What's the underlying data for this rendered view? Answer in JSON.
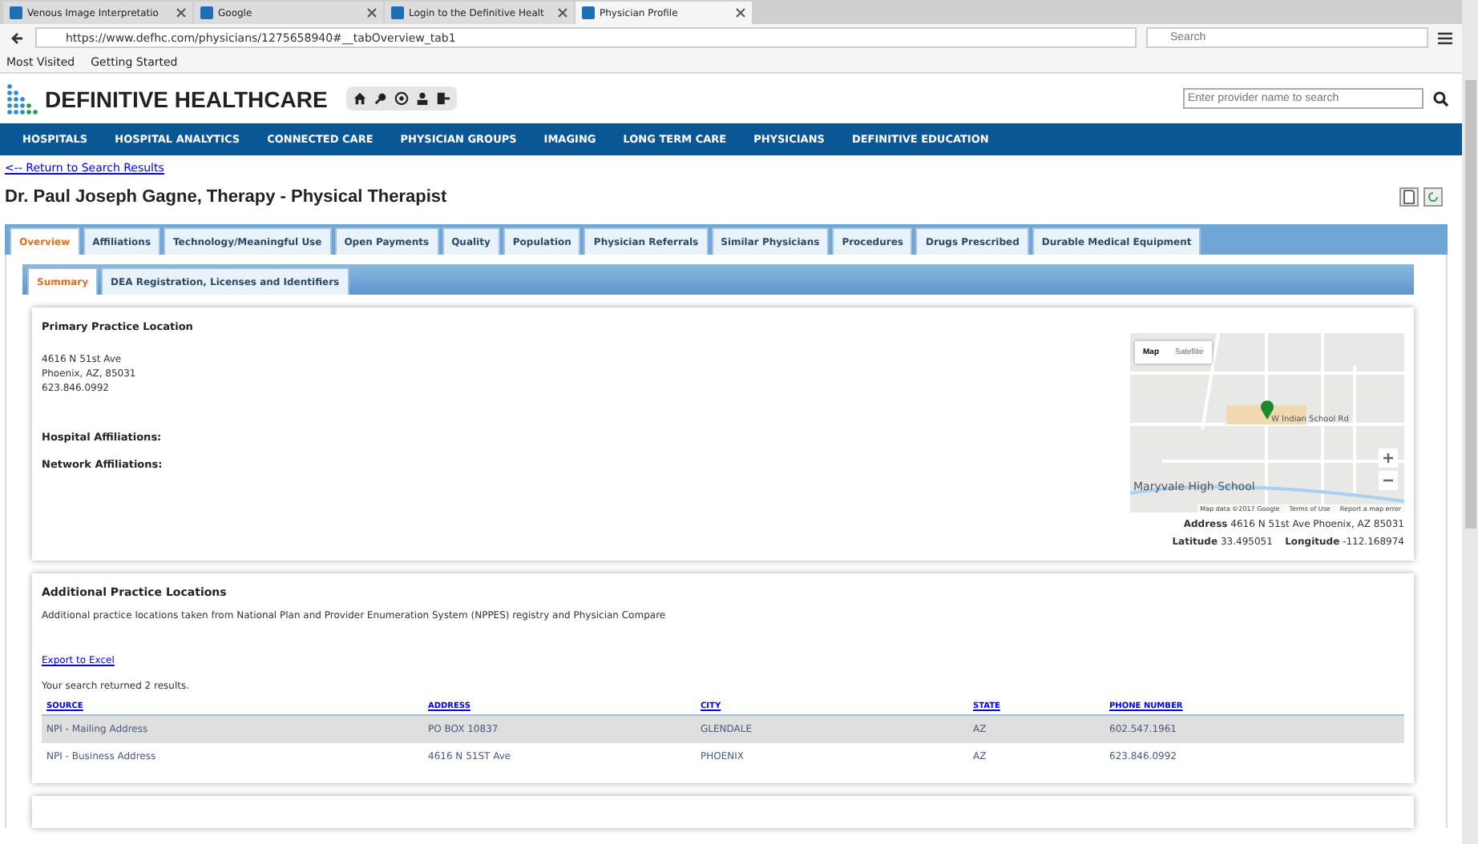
{
  "browser": {
    "tabs": [
      {
        "title": "Venous Image Interpretatio",
        "selected": false
      },
      {
        "title": "Google",
        "selected": false
      },
      {
        "title": "Login to the Definitive Healt",
        "selected": false
      },
      {
        "title": "Physician Profile",
        "selected": true
      }
    ],
    "url": "https://www.defhc.com/physicians/1275658940#__tabOverview_tab1",
    "search_placeholder": "Search",
    "bookmarks": [
      "Most Visited",
      "Getting Started"
    ]
  },
  "site": {
    "logo": "DEFINITIVE HEALTHCARE",
    "search_placeholder": "Enter provider name to search",
    "nav": [
      "HOSPITALS",
      "HOSPITAL ANALYTICS",
      "CONNECTED CARE",
      "PHYSICIAN GROUPS",
      "IMAGING",
      "LONG TERM CARE",
      "PHYSICIANS",
      "DEFINITIVE EDUCATION"
    ]
  },
  "back_link": "<-- Return to Search Results",
  "title": "Dr. Paul Joseph Gagne, Therapy - Physical Therapist",
  "tabs": [
    {
      "label": "Overview",
      "selected": true
    },
    {
      "label": "Affiliations",
      "selected": false
    },
    {
      "label": "Technology/Meaningful Use",
      "selected": false
    },
    {
      "label": "Open Payments",
      "selected": false
    },
    {
      "label": "Quality",
      "selected": false
    },
    {
      "label": "Population",
      "selected": false
    },
    {
      "label": "Physician Referrals",
      "selected": false
    },
    {
      "label": "Similar Physicians",
      "selected": false
    },
    {
      "label": "Procedures",
      "selected": false
    },
    {
      "label": "Drugs Prescribed",
      "selected": false
    },
    {
      "label": "Durable Medical Equipment",
      "selected": false
    }
  ],
  "subtabs": [
    {
      "label": "Summary",
      "selected": true
    },
    {
      "label": "DEA Registration, Licenses and Identifiers",
      "selected": false
    }
  ],
  "primary": {
    "heading": "Primary Practice Location",
    "address_lines": [
      "4616 N 51st Ave",
      "Phoenix, AZ, 85031",
      "623.846.0992"
    ],
    "labels": [
      "Hospital Affiliations:",
      "Network Affiliations:"
    ],
    "map": {
      "types": [
        {
          "label": "Map",
          "selected": true
        },
        {
          "label": "Satellite",
          "selected": false
        }
      ],
      "school": "Maryvale High School",
      "road": "W Indian School Rd",
      "attribution": [
        "Map data ©2017 Google",
        "Terms of Use",
        "Report a map error"
      ]
    },
    "address_label": "Address",
    "address": "4616 N 51st Ave Phoenix, AZ 85031",
    "latitude_label": "Latitude",
    "latitude": "33.495051",
    "longitude_label": "Longitude",
    "longitude": "-112.168974"
  },
  "additional": {
    "heading": "Additional Practice Locations",
    "description": "Additional practice locations taken from National Plan and Provider Enumeration System (NPPES) registry and Physician Compare",
    "export": "Export to Excel",
    "result_count": "Your search returned 2 results.",
    "columns": [
      "SOURCE",
      "ADDRESS",
      "CITY",
      "STATE",
      "PHONE NUMBER"
    ],
    "rows": [
      {
        "cells": [
          "NPI - Mailing Address",
          "PO BOX 10837",
          "GLENDALE",
          "AZ",
          "602.547.1961"
        ],
        "selected": true
      },
      {
        "cells": [
          "NPI - Business Address",
          "4616 N 51ST Ave",
          "PHOENIX",
          "AZ",
          "623.846.0992"
        ],
        "selected": false
      }
    ]
  }
}
